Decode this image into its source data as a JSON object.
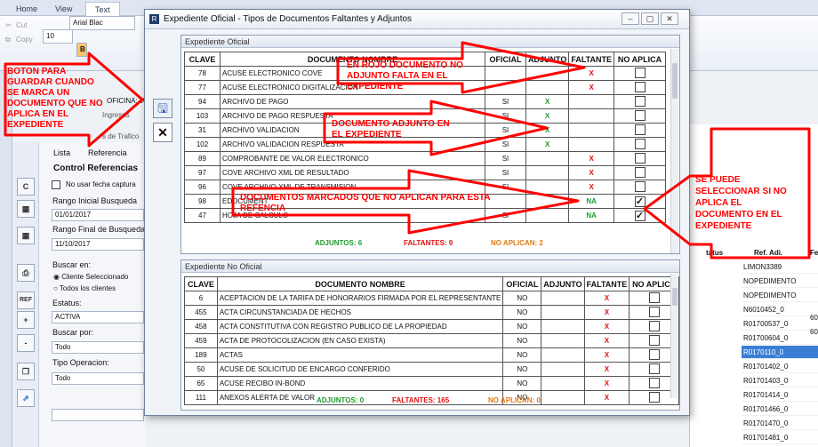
{
  "ribbon": {
    "tabs": [
      "Home",
      "View",
      "Text"
    ],
    "cut_label": "Cut",
    "copy_label": "Copy",
    "font_name": "Arial Blac",
    "font_size": "10",
    "bold": "B"
  },
  "bg": {
    "oficina": "OFICINA: JU",
    "ingresos": "Ingresos",
    "trafico": "s de Trafico",
    "tab_lista": "Lista",
    "tab_referencia": "Referencia",
    "control_referencias": "Control Referencias",
    "no_usar_fecha": "No usar fecha captura",
    "rango_inicial_label": "Rango Inicial Busqueda",
    "rango_inicial": "01/01/2017",
    "rango_final_label": "Rango Final de Busqueda",
    "rango_final": "11/10/2017",
    "buscar_en": "Buscar en:",
    "cliente_sel": "Cliente Seleccionado",
    "todos_clientes": "Todos los clientes",
    "estatus_label": "Estatus:",
    "estatus": "ACTIVA",
    "buscar_por": "Buscar por:",
    "buscar_por_val": "Todo",
    "tipo_op": "Tipo Operacion:",
    "tipo_op_val": "Todo",
    "ref_btn": "REF",
    "plus": "+",
    "minus": "-",
    "right_col_status": "tatus",
    "right_col_ref": "Ref. Adi.",
    "right_col_fe": "Fe",
    "right_rows": [
      "LIMON3389",
      "NOPEDIMENTO",
      "NOPEDIMENTO",
      "N6010452_0",
      "R01700537_0",
      "R01700604_0",
      "R0170110_0",
      "R01701402_0",
      "R01701403_0",
      "R01701414_0",
      "R01701466_0",
      "R01701470_0",
      "R01701481_0"
    ],
    "right_extra_1": "60",
    "right_extra_2": "60"
  },
  "dialog": {
    "title": "Expediente Oficial - Tipos de Documentos Faltantes y Adjuntos",
    "headers": {
      "clave": "CLAVE",
      "nombre": "DOCUMENTO NOMBRE",
      "oficial": "OFICIAL",
      "adjunto": "ADJUNTO",
      "faltante": "FALTANTE",
      "no_aplica": "NO APLICA"
    },
    "oficial_section": {
      "title": "Expediente Oficial",
      "rows": [
        {
          "clave": "78",
          "nombre": "ACUSE ELECTRONICO COVE",
          "oficial": "",
          "adjunto": "",
          "faltante": "X",
          "no_aplica": false
        },
        {
          "clave": "77",
          "nombre": "ACUSE ELECTRONICO DIGITALIZACION",
          "oficial": "",
          "adjunto": "",
          "faltante": "X",
          "no_aplica": false
        },
        {
          "clave": "94",
          "nombre": "ARCHIVO DE PAGO",
          "oficial": "SI",
          "adjunto": "X",
          "faltante": "",
          "no_aplica": false
        },
        {
          "clave": "103",
          "nombre": "ARCHIVO DE PAGO RESPUESTA",
          "oficial": "SI",
          "adjunto": "X",
          "faltante": "",
          "no_aplica": false
        },
        {
          "clave": "31",
          "nombre": "ARCHIVO VALIDACION",
          "oficial": "SI",
          "adjunto": "X",
          "faltante": "",
          "no_aplica": false
        },
        {
          "clave": "102",
          "nombre": "ARCHIVO VALIDACION RESPUESTA",
          "oficial": "SI",
          "adjunto": "X",
          "faltante": "",
          "no_aplica": false
        },
        {
          "clave": "89",
          "nombre": "COMPROBANTE DE VALOR ELECTRONICO",
          "oficial": "SI",
          "adjunto": "",
          "faltante": "X",
          "no_aplica": false
        },
        {
          "clave": "97",
          "nombre": "COVE ARCHIVO XML DE RESULTADO",
          "oficial": "SI",
          "adjunto": "",
          "faltante": "X",
          "no_aplica": false
        },
        {
          "clave": "96",
          "nombre": "COVE ARCHIVO XML DE TRANSMISION",
          "oficial": "SI",
          "adjunto": "",
          "faltante": "X",
          "no_aplica": false
        },
        {
          "clave": "98",
          "nombre": "EDOCUMENT",
          "oficial": "",
          "adjunto": "",
          "faltante": "NA",
          "no_aplica": true
        },
        {
          "clave": "47",
          "nombre": "HOJA DE CALCULO",
          "oficial": "SI",
          "adjunto": "",
          "faltante": "NA",
          "no_aplica": true
        }
      ],
      "adjuntos": "ADJUNTOS: 6",
      "faltantes": "FALTANTES: 9",
      "no_aplican": "NO APLICAN: 2"
    },
    "no_oficial_section": {
      "title": "Expediente No Oficial",
      "rows": [
        {
          "clave": "6",
          "nombre": "ACEPTACION DE LA TARIFA DE HONORARIOS FIRMADA POR EL REPRESENTANTE",
          "oficial": "NO",
          "adjunto": "",
          "faltante": "X",
          "no_aplica": false
        },
        {
          "clave": "455",
          "nombre": "ACTA CIRCUNSTANCIADA DE HECHOS",
          "oficial": "NO",
          "adjunto": "",
          "faltante": "X",
          "no_aplica": false
        },
        {
          "clave": "458",
          "nombre": "ACTA CONSTITUTIVA CON REGISTRO PUBLICO DE LA PROPIEDAD",
          "oficial": "NO",
          "adjunto": "",
          "faltante": "X",
          "no_aplica": false
        },
        {
          "clave": "459",
          "nombre": "ACTA DE PROTOCOLIZACION (EN CASO EXISTA)",
          "oficial": "NO",
          "adjunto": "",
          "faltante": "X",
          "no_aplica": false
        },
        {
          "clave": "189",
          "nombre": "ACTAS",
          "oficial": "NO",
          "adjunto": "",
          "faltante": "X",
          "no_aplica": false
        },
        {
          "clave": "50",
          "nombre": "ACUSE DE SOLICITUD DE ENCARGO CONFERIDO",
          "oficial": "NO",
          "adjunto": "",
          "faltante": "X",
          "no_aplica": false
        },
        {
          "clave": "65",
          "nombre": "ACUSE RECIBO IN-BOND",
          "oficial": "NO",
          "adjunto": "",
          "faltante": "X",
          "no_aplica": false
        },
        {
          "clave": "111",
          "nombre": "ANEXOS ALERTA DE VALOR",
          "oficial": "NO",
          "adjunto": "",
          "faltante": "X",
          "no_aplica": false
        }
      ],
      "adjuntos": "ADJUNTOS: 0",
      "faltantes": "FALTANTES: 165",
      "no_aplican": "NO APLICAN: 0"
    }
  },
  "annotations": {
    "boton": "BOTON PARA GUARDAR CUANDO SE MARCA UN DOCUMENTO QUE NO APLICA EN EL EXPEDIENTE",
    "rojo": "EN ROJO DOCUMENTO NO ADJUNTO FALTA EN EL EXPEDIENTE",
    "adjunto": "DOCUMENTO ADJUNTO EN EL EXPEDIENTE",
    "marcados": "DOCUMENTOS MARCADOS QUE NO APLICAN PARA ESTA REFENCIA",
    "seleccionar": "SE PUEDE SELECCIONAR SI NO APLICA EL DOCUMENTO EN EL EXPEDIENTE"
  },
  "colors": {
    "annotation": "#ff0000",
    "faltante": "#e01010",
    "adjunto": "#1f9a2e",
    "no_aplican": "#e07a10",
    "selected_row": "#3a7fd5"
  }
}
